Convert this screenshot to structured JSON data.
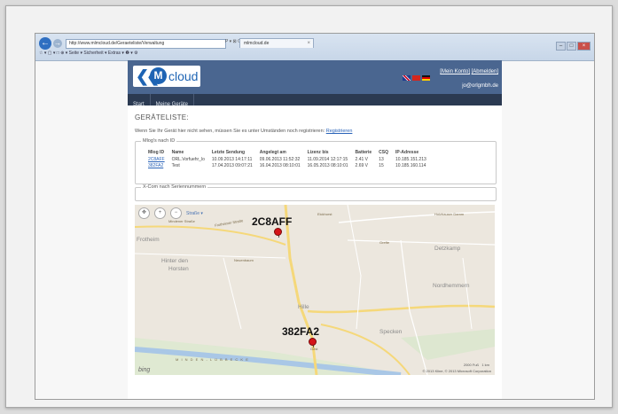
{
  "browser": {
    "address": "http://www.mlmcloud.de/Geraeteliste/Verwaltung",
    "address_tools": "P ▾ ⊠ C",
    "tab_title": "mlmcloud.de",
    "toolbar": "☆ ▾ ▢ ▾ □ ⊕ ▾ Seite ▾ Sicherheit ▾ Extras ▾ ❷ ▾ ⚙"
  },
  "header": {
    "logo_text": "cloud",
    "logo_m": "M",
    "logo_chevrons": "❮❮",
    "account_link": "[Mein Konto]",
    "logout_link": "[Abmelden]",
    "user_email": "jo@orlgmbh.de"
  },
  "nav": {
    "items": [
      "Start",
      "Meine Geräte"
    ]
  },
  "page": {
    "title": "GERÄTELISTE:",
    "info_text": "Wenn Sie Ihr Gerät hier nicht sehen, müssen Sie es unter Umständen noch registrieren:",
    "register_link": "Registrieren"
  },
  "devices_box": {
    "legend": "Mlog's nach ID",
    "columns": [
      "Mlog ID",
      "Name",
      "Letzte Sendung",
      "Angelegt am",
      "Lizenz bis",
      "Batterie",
      "CSQ",
      "IP-Adresse"
    ],
    "rows": [
      [
        "2C8AFF",
        "ORL.Vorfuehr_lo",
        "10.09.2013 14:17:11",
        "09.06.2013 11:52:32",
        "11.09.2014 12:17:15",
        "2.41 V",
        "13",
        "10.185.151.213"
      ],
      [
        "382FA2",
        "Test",
        "17.04.2013 09:07:21",
        "16.04.2013 08:10:01",
        "16.05.2013 08:10:01",
        "2.69 V",
        "15",
        "10.185.160.114"
      ]
    ]
  },
  "xcom_box": {
    "legend": "X-Com nach Seriennummern"
  },
  "map": {
    "type_label": "Straße ▾",
    "marker1": "2C8AFF",
    "marker2": "382FA2",
    "places": {
      "frotheim": "Frotheim",
      "hinter_den": "Hinter den",
      "horsten": "Horsten",
      "hille": "Hille",
      "detzkamp": "Detzkamp",
      "nordhemmern": "Nordhemmern",
      "specken": "Specken",
      "neuenbaum": "Neuenbaum",
      "holzhauser_damm": "Holzhauser Damm",
      "grefte": "Grefte",
      "minderner_strasse": "Mindener Straße",
      "frotheimer_strasse": "Frotheimer Straße",
      "eickhorst": "Eickhorst",
      "canal": "M I N D E N - L Ü B B E C K E",
      "girst": "Girst"
    },
    "scale": "2000 Fuß",
    "scale2": "1 km",
    "attribution": "© 2013 Kline, © 2013 Microsoft Corporation",
    "provider": "bing"
  },
  "colors": {
    "header": "#4a6690",
    "navbar": "#2b3a52",
    "link": "#2a63b8",
    "marker": "#d4141a"
  }
}
